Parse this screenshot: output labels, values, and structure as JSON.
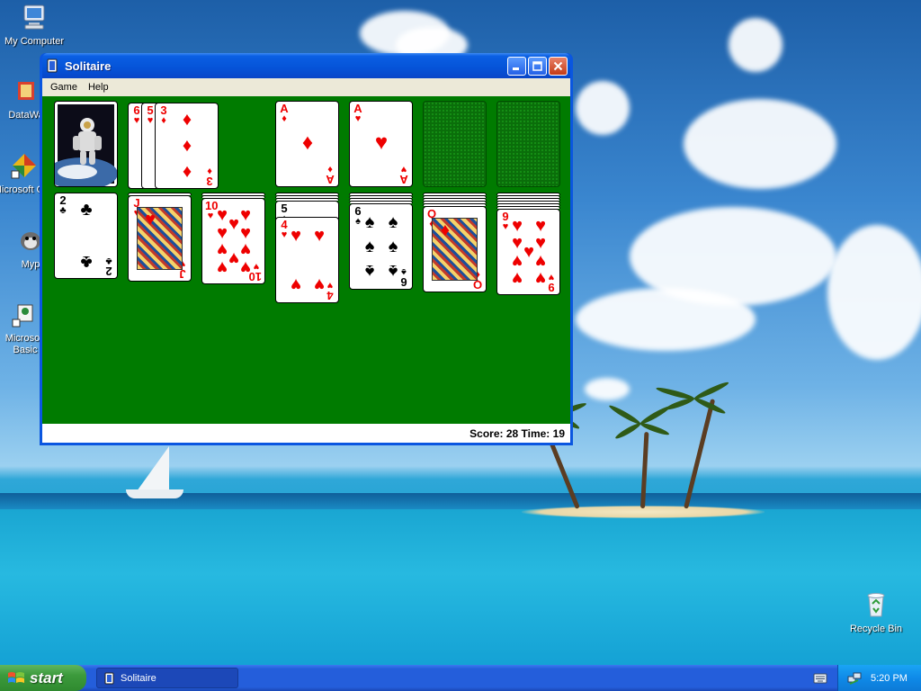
{
  "desktop": {
    "icons": [
      {
        "label": "My Computer",
        "icon": "computer-icon"
      },
      {
        "label": "DataWa",
        "icon": "app-shortcut-icon"
      },
      {
        "label": "Microsoft C++",
        "icon": "visual-cpp-icon"
      },
      {
        "label": "Myp",
        "icon": "app-shortcut-icon"
      },
      {
        "label": "Microsoft Basic",
        "icon": "visual-basic-icon"
      },
      {
        "label": "Recycle Bin",
        "icon": "recycle-bin-icon"
      }
    ]
  },
  "window": {
    "title": "Solitaire",
    "menu": [
      "Game",
      "Help"
    ],
    "status": "Score: 28 Time: 19"
  },
  "game": {
    "stock": {
      "back_design": "astronaut"
    },
    "waste": [
      {
        "rank": "6",
        "suit": "♥",
        "color": "red"
      },
      {
        "rank": "5",
        "suit": "♥",
        "color": "red"
      },
      {
        "rank": "3",
        "suit": "♦",
        "color": "red"
      }
    ],
    "foundations": [
      {
        "rank": "A",
        "suit": "♦",
        "color": "red"
      },
      {
        "rank": "A",
        "suit": "♥",
        "color": "red"
      },
      {
        "empty": true
      },
      {
        "empty": true
      }
    ],
    "tableau": [
      {
        "hidden": 0,
        "cards": [
          {
            "rank": "2",
            "suit": "♣",
            "color": "black"
          }
        ]
      },
      {
        "hidden": 1,
        "cards": [
          {
            "rank": "J",
            "suit": "♥",
            "color": "red"
          }
        ]
      },
      {
        "hidden": 2,
        "cards": [
          {
            "rank": "10",
            "suit": "♥",
            "color": "red"
          }
        ]
      },
      {
        "hidden": 3,
        "cards": [
          {
            "rank": "5",
            "suit": "♠",
            "color": "black"
          },
          {
            "rank": "4",
            "suit": "♥",
            "color": "red"
          }
        ]
      },
      {
        "hidden": 4,
        "cards": [
          {
            "rank": "6",
            "suit": "♠",
            "color": "black"
          }
        ]
      },
      {
        "hidden": 5,
        "cards": [
          {
            "rank": "Q",
            "suit": "♦",
            "color": "red"
          }
        ]
      },
      {
        "hidden": 6,
        "cards": [
          {
            "rank": "9",
            "suit": "♥",
            "color": "red"
          }
        ]
      }
    ]
  },
  "taskbar": {
    "start_label": "start",
    "task_label": "Solitaire",
    "clock": "5:20 PM"
  },
  "colors": {
    "felt": "#007b00",
    "title_bar": "#0553d8",
    "taskbar": "#245edb",
    "start_button": "#3c9a3c",
    "tray": "#0f8ae8"
  }
}
